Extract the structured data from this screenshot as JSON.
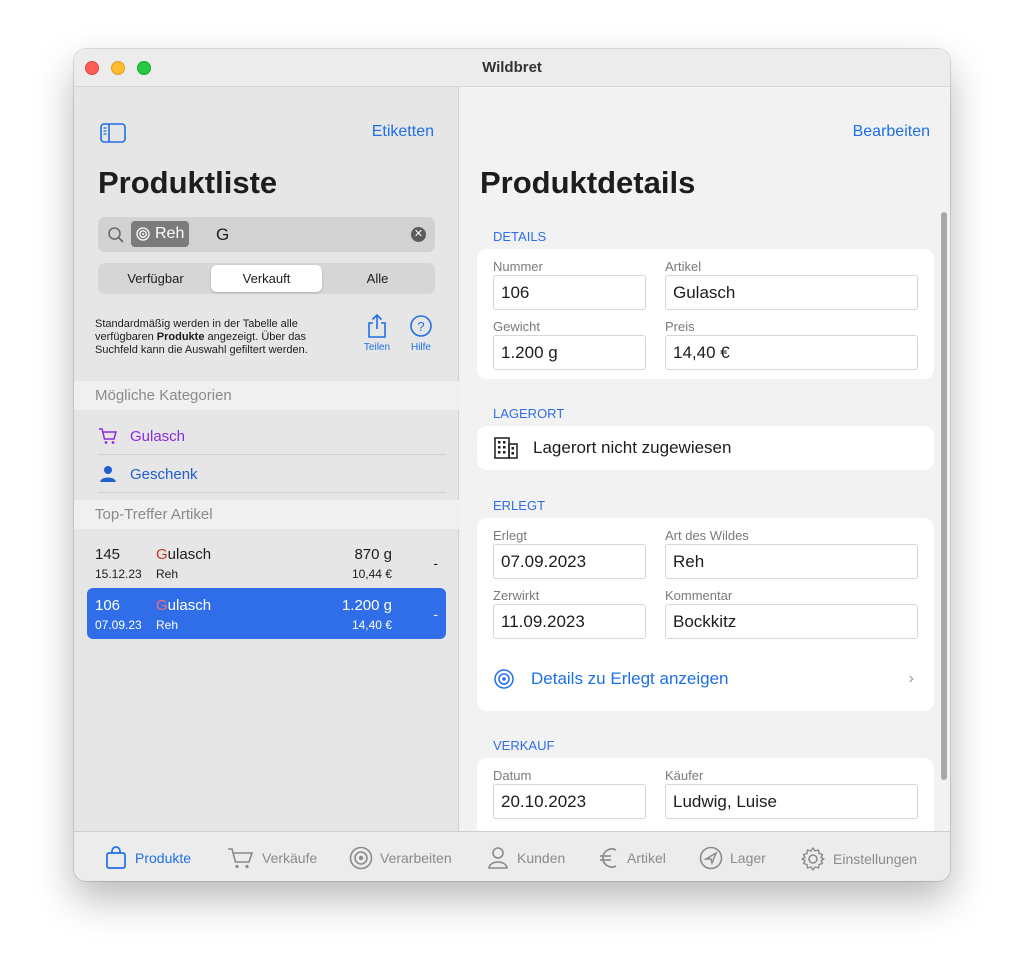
{
  "window": {
    "title": "Wildbret"
  },
  "sidebar": {
    "etiketten_label": "Etiketten",
    "title": "Produktliste",
    "search": {
      "token": "Reh",
      "text": "G"
    },
    "segments": [
      "Verfügbar",
      "Verkauft",
      "Alle"
    ],
    "help_pre": "Standardmäßig werden in der Tabelle alle verfügbaren ",
    "help_bold": "Produkte",
    "help_post": " angezeigt. Über das Suchfeld kann die Auswahl gefiltert werden.",
    "teilen_label": "Teilen",
    "hilfe_label": "Hilfe",
    "categories_header": "Mögliche Kategorien",
    "categories": [
      "Gulasch",
      "Geschenk"
    ],
    "top_header": "Top-Treffer Artikel",
    "results": [
      {
        "num": "145",
        "date": "15.12.23",
        "name_hl": "G",
        "name_rest": "ulasch",
        "type": "Reh",
        "weight": "870 g",
        "price": "10,44 €",
        "dash": "-"
      },
      {
        "num": "106",
        "date": "07.09.23",
        "name_hl": "G",
        "name_rest": "ulasch",
        "type": "Reh",
        "weight": "1.200 g",
        "price": "14,40 €",
        "dash": "-"
      }
    ]
  },
  "detail": {
    "bearbeiten_label": "Bearbeiten",
    "title": "Produktdetails",
    "details": {
      "label": "DETAILS",
      "nummer_label": "Nummer",
      "nummer": "106",
      "artikel_label": "Artikel",
      "artikel": "Gulasch",
      "gewicht_label": "Gewicht",
      "gewicht": "1.200 g",
      "preis_label": "Preis",
      "preis": "14,40 €"
    },
    "lagerort": {
      "label": "LAGERORT",
      "value": "Lagerort nicht zugewiesen"
    },
    "erlegt": {
      "label": "ERLEGT",
      "erlegt_label": "Erlegt",
      "erlegt": "07.09.2023",
      "art_label": "Art des Wildes",
      "art": "Reh",
      "zerwirkt_label": "Zerwirkt",
      "zerwirkt": "11.09.2023",
      "kommentar_label": "Kommentar",
      "kommentar": "Bockkitz",
      "link": "Details zu Erlegt anzeigen"
    },
    "verkauf": {
      "label": "VERKAUF",
      "datum_label": "Datum",
      "datum": "20.10.2023",
      "kaeufer_label": "Käufer",
      "kaeufer": "Ludwig, Luise"
    }
  },
  "tabs": [
    "Produkte",
    "Verkäufe",
    "Verarbeiten",
    "Kunden",
    "Artikel",
    "Lager",
    "Einstellungen"
  ],
  "colors": {
    "accent": "#1f6fe8",
    "selection": "#2f6ee8",
    "category_gulasch": "#8a2be2"
  }
}
